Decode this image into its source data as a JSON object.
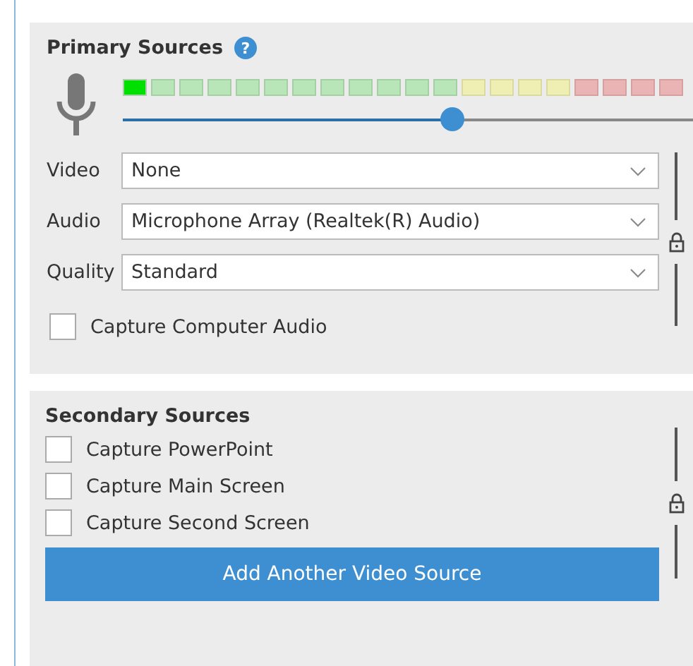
{
  "primary_sources": {
    "title": "Primary Sources",
    "help": "?",
    "meter": {
      "level": 0.05
    },
    "volume": {
      "level": 0.555
    },
    "fields": [
      {
        "label": "Video",
        "value": "None"
      },
      {
        "label": "Audio",
        "value": "Microphone Array (Realtek(R) Audio)"
      },
      {
        "label": "Quality",
        "value": "Standard"
      }
    ],
    "capture_computer_audio": {
      "label": "Capture Computer Audio",
      "checked": false
    }
  },
  "secondary_sources": {
    "title": "Secondary Sources",
    "options": [
      {
        "label": "Capture PowerPoint",
        "checked": false
      },
      {
        "label": "Capture Main Screen",
        "checked": false
      },
      {
        "label": "Capture Second Screen",
        "checked": false
      }
    ],
    "button": "Add Another Video Source"
  }
}
